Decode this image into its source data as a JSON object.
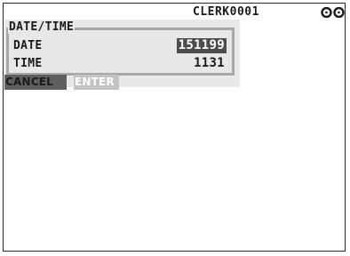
{
  "status_bar": {
    "clerk": "CLERK0001",
    "mode_icon": "key-mode-icon"
  },
  "dialog": {
    "title": "DATE/TIME",
    "fields": [
      {
        "label": "DATE",
        "value": "151199",
        "active": true
      },
      {
        "label": "TIME",
        "value": "1131",
        "active": false
      }
    ]
  },
  "buttons": {
    "cancel": "CANCEL",
    "enter": "ENTER"
  },
  "colors": {
    "panel_background": "#e8e8e8",
    "frame": "#a7a7a7",
    "active_value_background": "#4d4d4d",
    "cancel_background": "#5f5f5f",
    "enter_background": "#c3c3c3"
  }
}
